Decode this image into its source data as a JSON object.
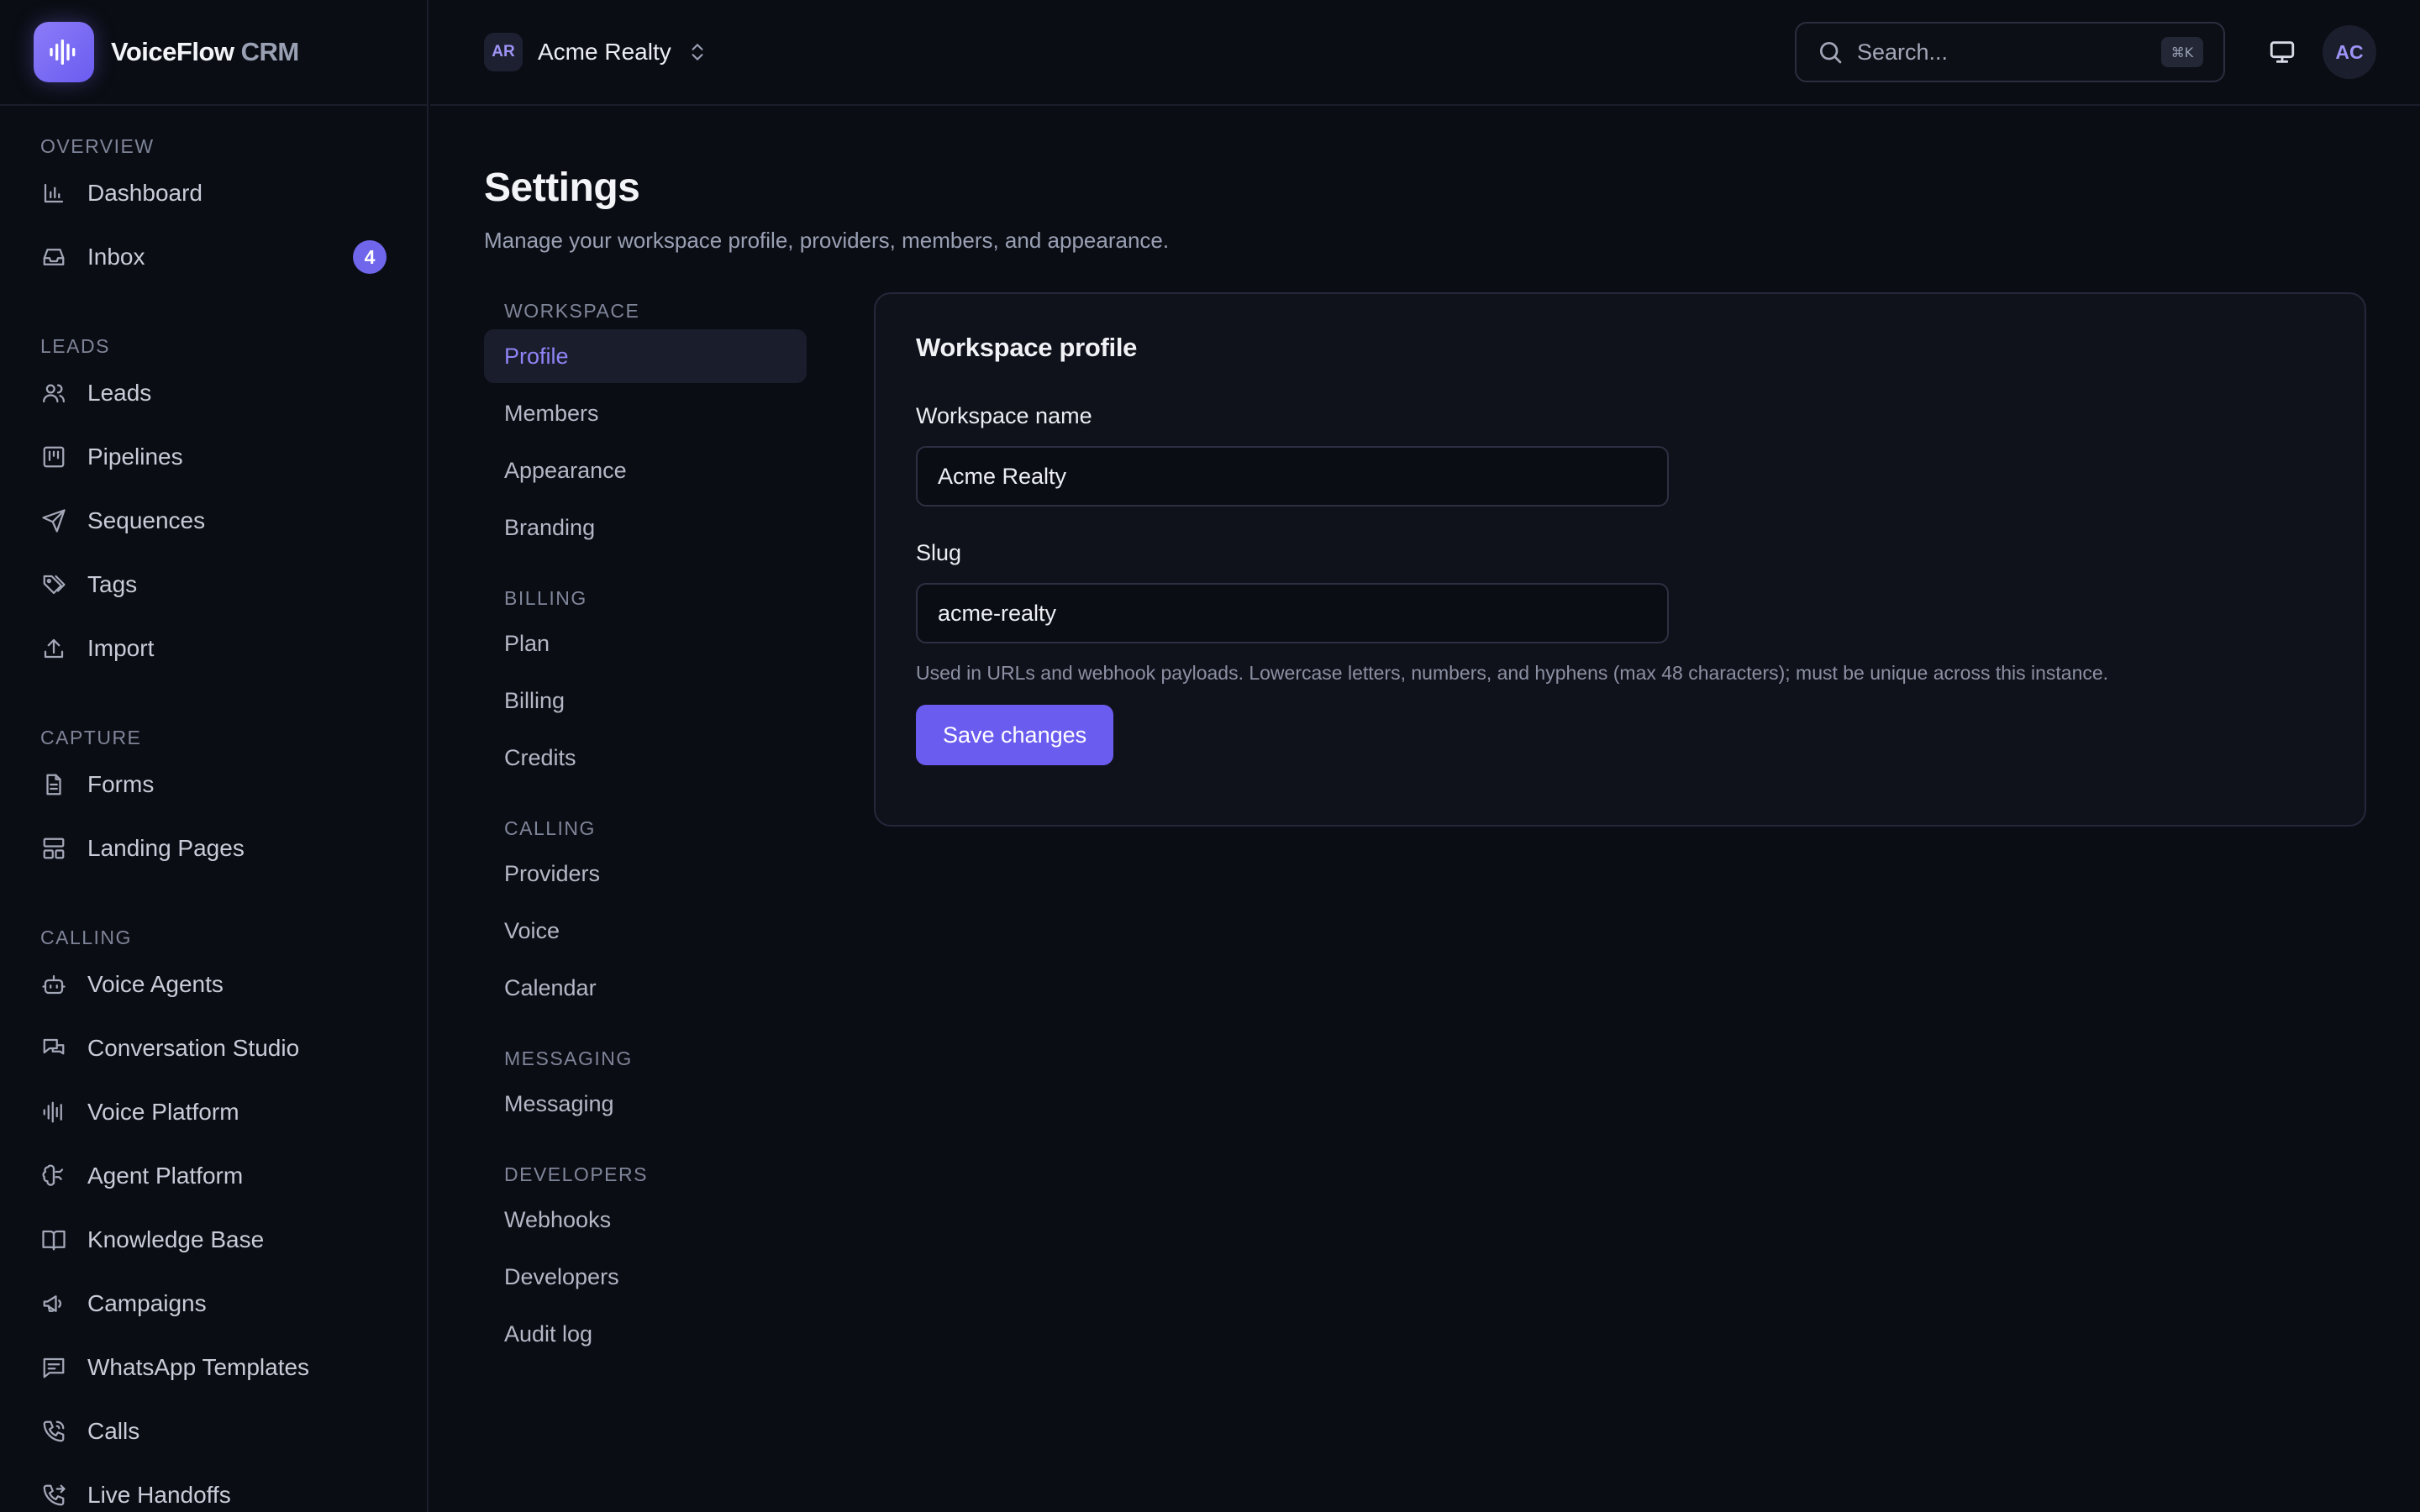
{
  "brand": {
    "name": "VoiceFlow",
    "suffix": "CRM"
  },
  "sidebar": {
    "sections": [
      {
        "heading": "Overview",
        "items": [
          {
            "label": "Dashboard",
            "icon": "bar-chart-icon"
          },
          {
            "label": "Inbox",
            "icon": "inbox-icon",
            "badge": "4"
          }
        ]
      },
      {
        "heading": "Leads",
        "items": [
          {
            "label": "Leads",
            "icon": "users-icon"
          },
          {
            "label": "Pipelines",
            "icon": "kanban-icon"
          },
          {
            "label": "Sequences",
            "icon": "send-icon"
          },
          {
            "label": "Tags",
            "icon": "tags-icon"
          },
          {
            "label": "Import",
            "icon": "upload-icon"
          }
        ]
      },
      {
        "heading": "Capture",
        "items": [
          {
            "label": "Forms",
            "icon": "file-text-icon"
          },
          {
            "label": "Landing Pages",
            "icon": "layout-icon"
          }
        ]
      },
      {
        "heading": "Calling",
        "items": [
          {
            "label": "Voice Agents",
            "icon": "bot-icon"
          },
          {
            "label": "Conversation Studio",
            "icon": "messages-icon"
          },
          {
            "label": "Voice Platform",
            "icon": "audio-lines-icon"
          },
          {
            "label": "Agent Platform",
            "icon": "brain-icon"
          },
          {
            "label": "Knowledge Base",
            "icon": "book-open-icon"
          },
          {
            "label": "Campaigns",
            "icon": "megaphone-icon"
          },
          {
            "label": "WhatsApp Templates",
            "icon": "message-square-icon"
          },
          {
            "label": "Calls",
            "icon": "phone-icon"
          },
          {
            "label": "Live Handoffs",
            "icon": "phone-forwarded-icon"
          }
        ]
      }
    ]
  },
  "topbar": {
    "workspace_initials": "AR",
    "workspace_name": "Acme Realty",
    "search_placeholder": "Search...",
    "search_shortcut": "⌘K",
    "user_initials": "AC"
  },
  "page": {
    "title": "Settings",
    "subtitle": "Manage your workspace profile, providers, members, and appearance."
  },
  "settings_nav": [
    {
      "heading": "Workspace",
      "items": [
        "Profile",
        "Members",
        "Appearance",
        "Branding"
      ]
    },
    {
      "heading": "Billing",
      "items": [
        "Plan",
        "Billing",
        "Credits"
      ]
    },
    {
      "heading": "Calling",
      "items": [
        "Providers",
        "Voice",
        "Calendar"
      ]
    },
    {
      "heading": "Messaging",
      "items": [
        "Messaging"
      ]
    },
    {
      "heading": "Developers",
      "items": [
        "Webhooks",
        "Developers",
        "Audit log"
      ]
    }
  ],
  "active_settings_item": "Profile",
  "profile_card": {
    "title": "Workspace profile",
    "name_label": "Workspace name",
    "name_value": "Acme Realty",
    "slug_label": "Slug",
    "slug_value": "acme-realty",
    "slug_hint": "Used in URLs and webhook payloads. Lowercase letters, numbers, and hyphens (max 48 characters); must be unique across this instance.",
    "save_label": "Save changes"
  },
  "colors": {
    "accent": "#6b5cf0",
    "background": "#0b0d14",
    "card": "#10121b",
    "active_text": "#8f84f5"
  }
}
